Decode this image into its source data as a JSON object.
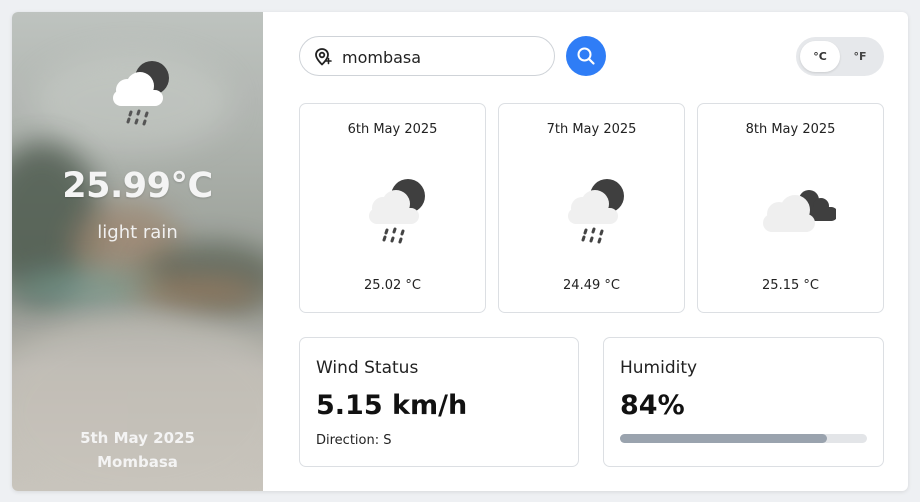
{
  "current": {
    "icon": "cloud-rain-moon-icon",
    "temperature": "25.99°C",
    "description": "light rain",
    "date": "5th May 2025",
    "city": "Mombasa"
  },
  "search": {
    "value": "mombasa",
    "icon": "map-pin-icon",
    "button_icon": "search-icon"
  },
  "units": {
    "celsius": "°C",
    "fahrenheit": "°F",
    "selected": "°C"
  },
  "forecast": [
    {
      "date": "6th May 2025",
      "icon": "cloud-rain-moon-icon",
      "temp": "25.02 °C"
    },
    {
      "date": "7th May 2025",
      "icon": "cloud-rain-moon-icon",
      "temp": "24.49 °C"
    },
    {
      "date": "8th May 2025",
      "icon": "clouds-icon",
      "temp": "25.15 °C"
    }
  ],
  "wind": {
    "label": "Wind Status",
    "value": "5.15 km/h",
    "direction": "Direction: S"
  },
  "humidity": {
    "label": "Humidity",
    "value": "84%",
    "percent": 84
  },
  "colors": {
    "accent": "#2f7df6",
    "humidity_bar": "#9aa3ae"
  }
}
